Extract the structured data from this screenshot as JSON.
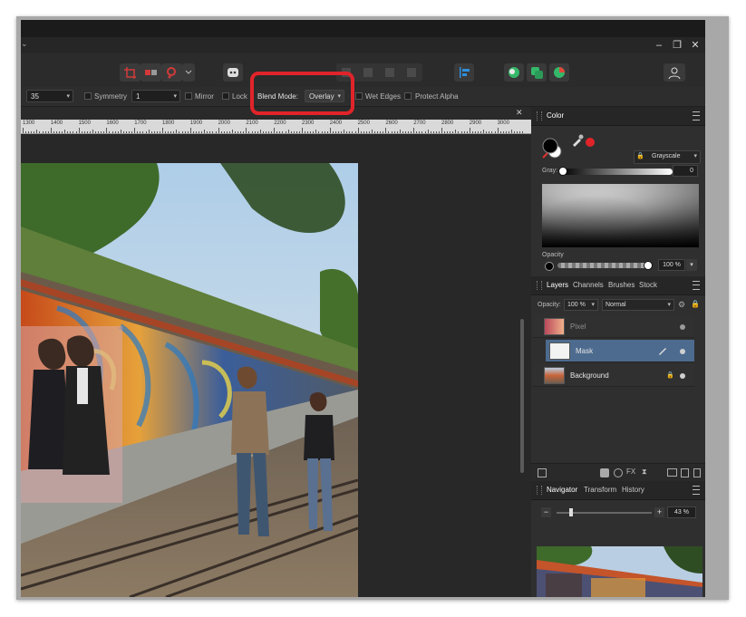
{
  "window": {
    "minimize_glyph": "–",
    "restore_glyph": "❐",
    "close_glyph": "✕",
    "chevron_glyph": "⌄"
  },
  "context_toolbar": {
    "size_value": "35",
    "symmetry_label": "Symmetry",
    "symmetry_value": "1",
    "mirror_label": "Mirror",
    "lock_label": "Lock",
    "blend_mode_label": "Blend Mode:",
    "blend_mode_value": "Overlay",
    "wet_edges_label": "Wet Edges",
    "protect_alpha_label": "Protect Alpha"
  },
  "document": {
    "close_glyph": "✕",
    "ruler_ticks": [
      "1300",
      "1400",
      "1500",
      "1600",
      "1700",
      "1800",
      "1900",
      "2000",
      "2100",
      "2200",
      "2300",
      "2400",
      "2500",
      "2600",
      "2700",
      "2800",
      "2900",
      "3000"
    ]
  },
  "color_panel": {
    "tab_label": "Color",
    "mode_value": "Grayscale",
    "gray_label": "Gray:",
    "gray_value": "0",
    "opacity_label": "Opacity",
    "opacity_value": "100 %"
  },
  "layers_panel": {
    "tabs": [
      "Layers",
      "Channels",
      "Brushes",
      "Stock"
    ],
    "opacity_label": "Opacity:",
    "opacity_value": "100 %",
    "blend_value": "Normal",
    "layers": [
      {
        "name": "Pixel",
        "state": "dimmed"
      },
      {
        "name": "Mask",
        "state": "selected"
      },
      {
        "name": "Background",
        "state": "locked"
      }
    ]
  },
  "navigator_panel": {
    "tabs": [
      "Navigator",
      "Transform",
      "History"
    ],
    "zoom_minus": "−",
    "zoom_plus": "+",
    "zoom_value": "43 %"
  },
  "colors": {
    "accent_selected": "#4d6b8f",
    "highlight_box": "#e0242a",
    "primary_color": "#000000",
    "secondary_color": "#ffffff",
    "picker_dot": "#e0242a"
  }
}
